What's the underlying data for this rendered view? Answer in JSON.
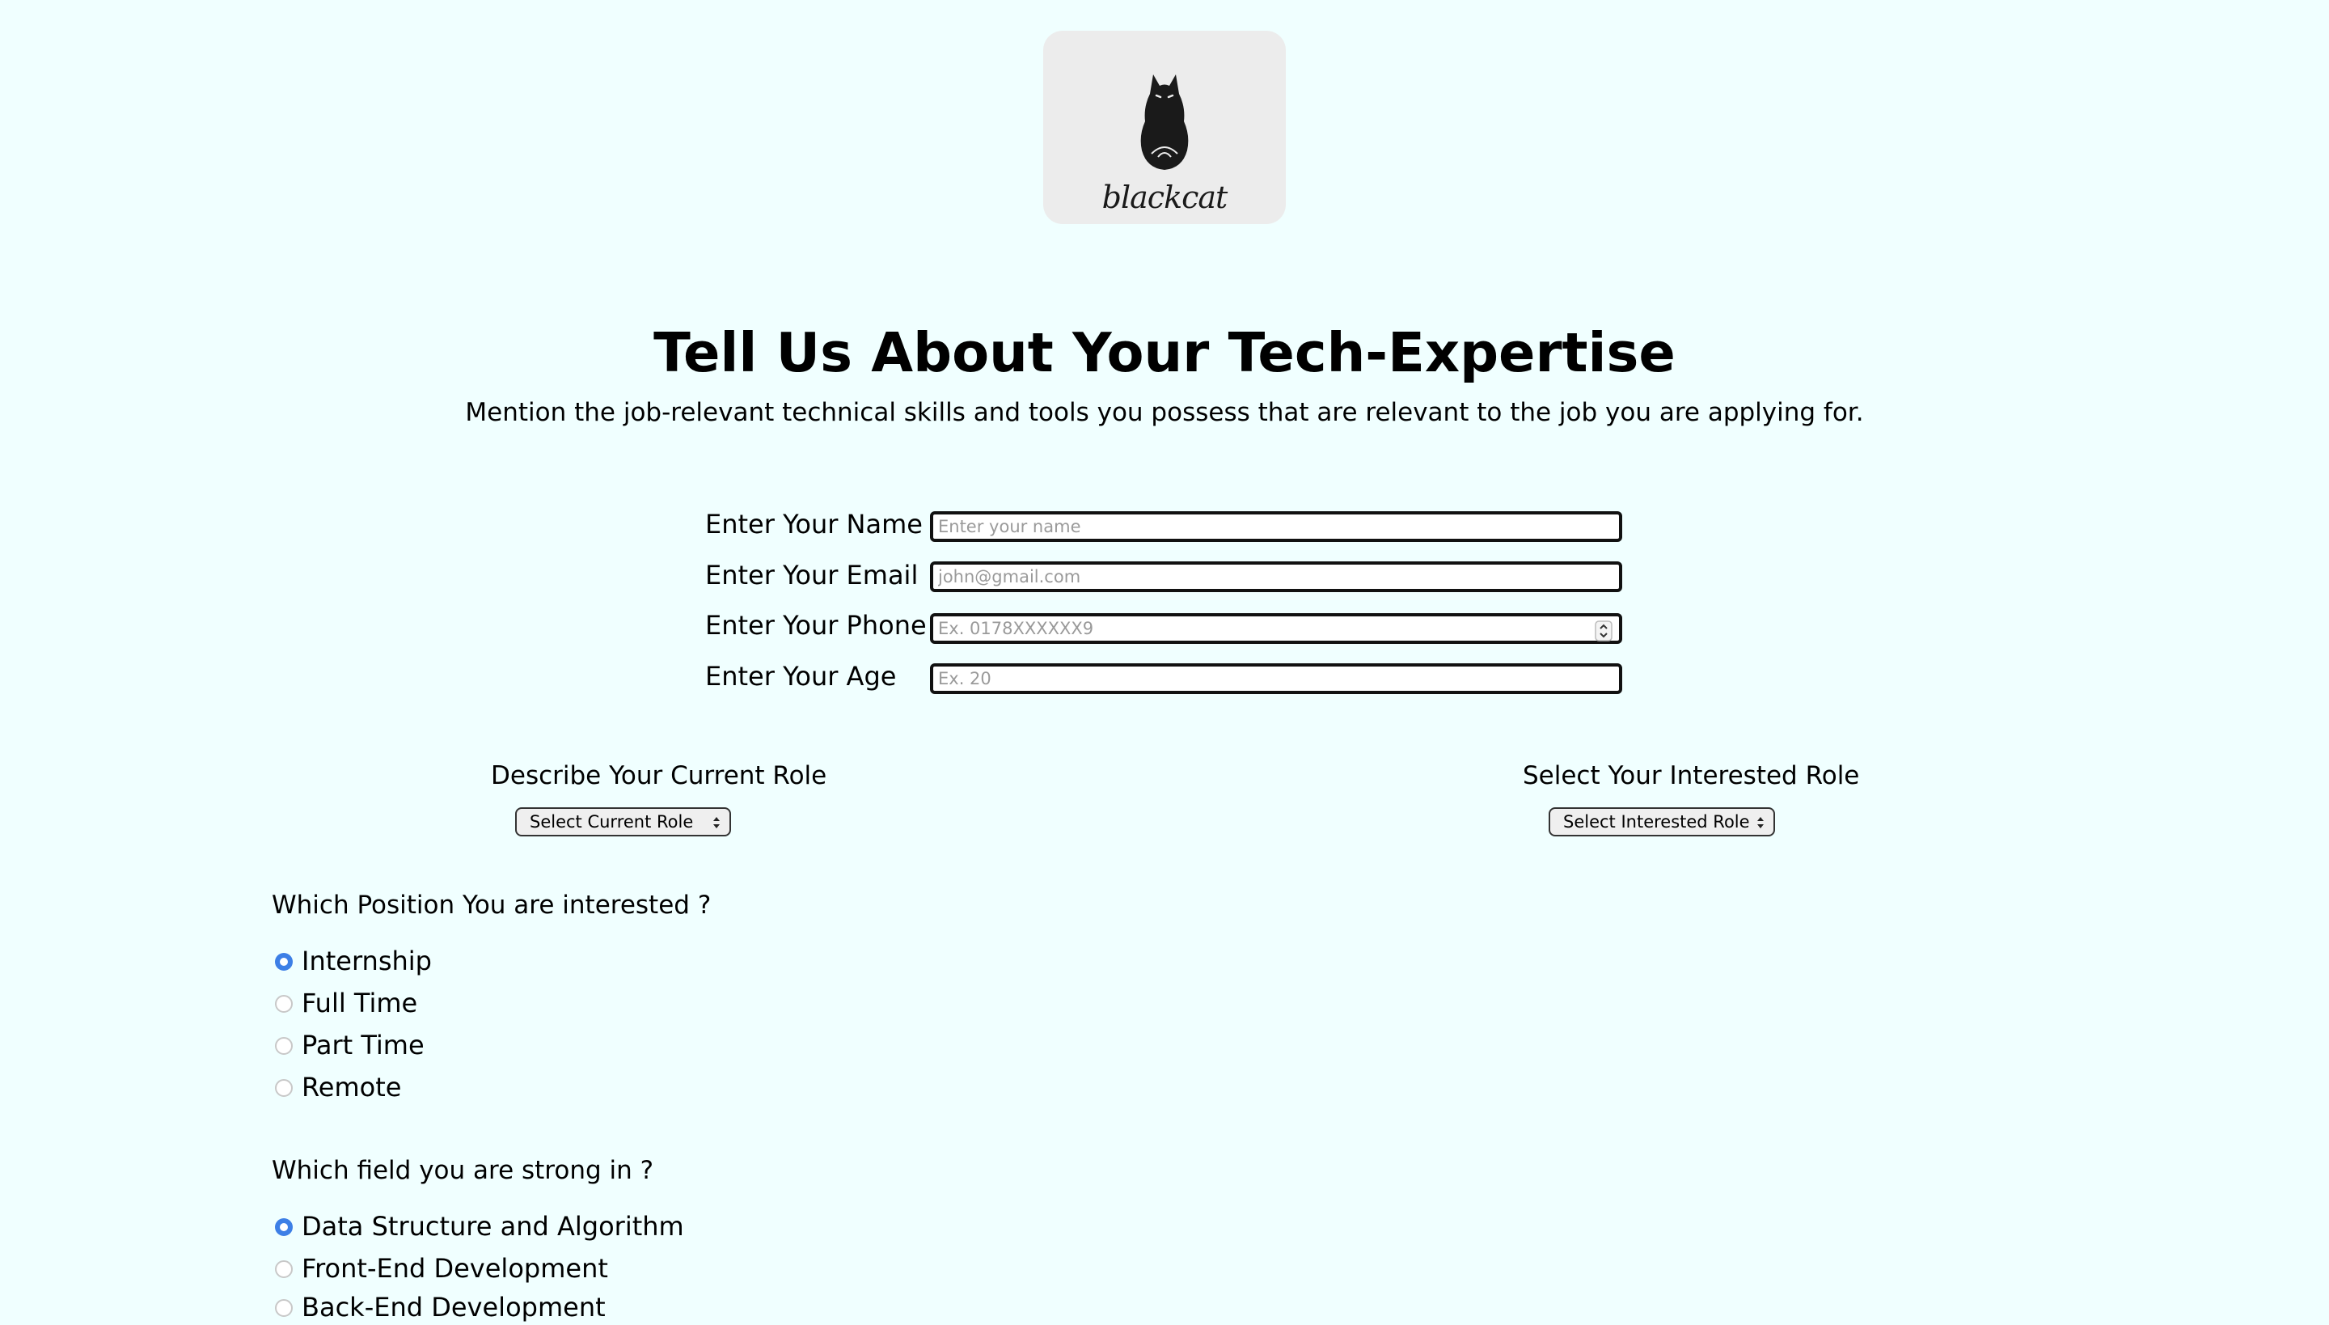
{
  "logo": {
    "text": "blackcat",
    "icon": "cat-icon"
  },
  "header": {
    "title": "Tell Us About Your Tech-Expertise",
    "subtitle": "Mention the job-relevant technical skills and tools you possess that are relevant to the job you are applying for."
  },
  "form": {
    "name": {
      "label": "Enter Your Name",
      "value": "",
      "placeholder": "Enter your name"
    },
    "email": {
      "label": "Enter Your Email",
      "value": "",
      "placeholder": "john@gmail.com"
    },
    "phone": {
      "label": "Enter Your Phone",
      "value": "",
      "placeholder": "Ex. 0178XXXXXX9"
    },
    "age": {
      "label": "Enter Your Age",
      "value": "",
      "placeholder": "Ex. 20"
    }
  },
  "roles": {
    "current": {
      "label": "Describe Your Current Role",
      "selected": "Select Current Role"
    },
    "interested": {
      "label": "Select Your Interested Role",
      "selected": "Select Interested Role"
    }
  },
  "position": {
    "question": "Which Position You are interested ?",
    "options": [
      {
        "label": "Internship",
        "checked": true
      },
      {
        "label": "Full Time",
        "checked": false
      },
      {
        "label": "Part Time",
        "checked": false
      },
      {
        "label": "Remote",
        "checked": false
      }
    ]
  },
  "field": {
    "question": "Which field you are strong in ?",
    "options": [
      {
        "label": "Data Structure and Algorithm",
        "checked": true
      },
      {
        "label": "Front-End Development",
        "checked": false
      },
      {
        "label": "Back-End Development",
        "checked": false
      }
    ]
  },
  "colors": {
    "page_background": "#f0ffff",
    "logo_background": "#ececec",
    "radio_accent": "#3d7fe6"
  }
}
